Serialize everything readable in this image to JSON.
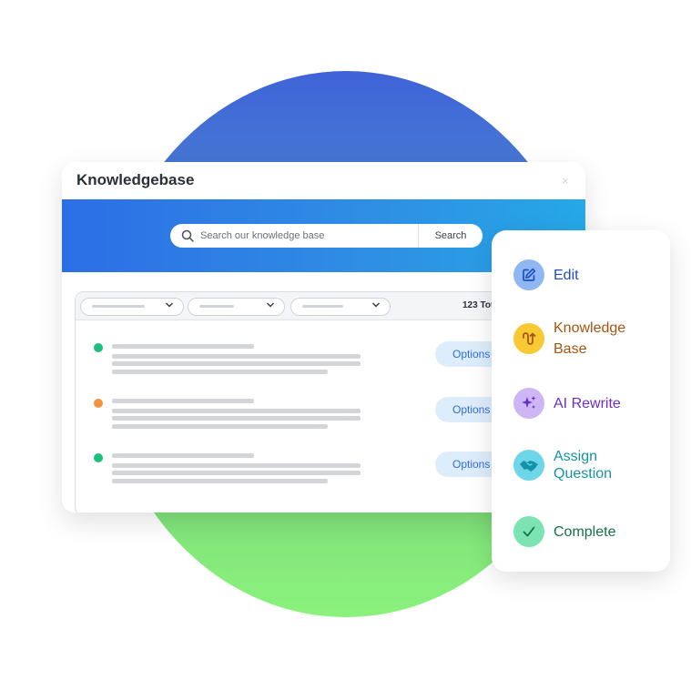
{
  "window": {
    "title": "Knowledgebase",
    "close_glyph": "×"
  },
  "search": {
    "placeholder": "Search our knowledge base",
    "button_label": "Search"
  },
  "list": {
    "total_text": "123 Tot",
    "rows": [
      {
        "status_color": "#1dbf7a",
        "options_label": "Options"
      },
      {
        "status_color": "#f5923e",
        "options_label": "Options"
      },
      {
        "status_color": "#1dbf7a",
        "options_label": "Options"
      }
    ]
  },
  "actions": [
    {
      "label_lines": [
        "Edit"
      ],
      "icon": "edit-icon",
      "icon_bg": "#8fb8f2",
      "text_color": "#1f4fc2"
    },
    {
      "label_lines": [
        "Knowledge",
        "Base"
      ],
      "icon": "knowledge-base-icon",
      "icon_bg": "#f9c933",
      "text_color": "#a65410"
    },
    {
      "label_lines": [
        "AI Rewrite"
      ],
      "icon": "sparkles-icon",
      "icon_bg": "#cdb6f3",
      "text_color": "#6a2fc9"
    },
    {
      "label_lines": [
        "Assign",
        "Question"
      ],
      "icon": "handshake-icon",
      "icon_bg": "#6fd6ea",
      "text_color": "#1492a8"
    },
    {
      "label_lines": [
        "Complete"
      ],
      "icon": "check-icon",
      "icon_bg": "#7ce3b2",
      "text_color": "#167048"
    }
  ]
}
